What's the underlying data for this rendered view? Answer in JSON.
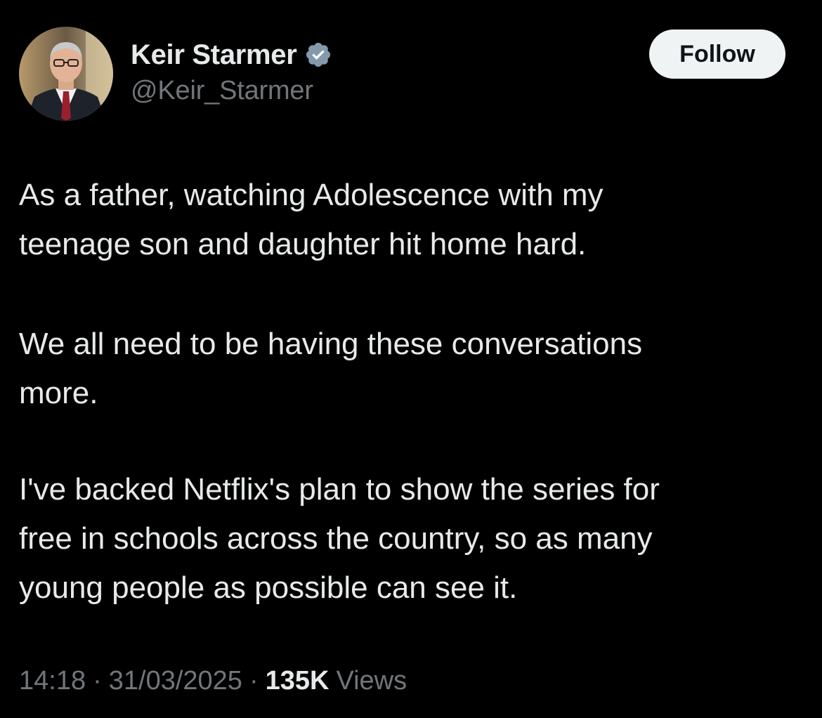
{
  "author": {
    "display_name": "Keir Starmer",
    "handle": "@Keir_Starmer",
    "verified": true,
    "avatar_icon": "profile-photo"
  },
  "follow_button": {
    "label": "Follow"
  },
  "tweet": {
    "paragraphs": [
      [
        "As a father, watching Adolescence with my",
        "teenage son and daughter hit home hard."
      ],
      [
        "We all need to be having these conversations",
        "more."
      ],
      [
        "I've backed Netflix's plan to show the series for",
        "free in schools across the country, so as many",
        "young people as possible can see it."
      ]
    ]
  },
  "meta": {
    "time": "14:18",
    "separator": "·",
    "date": "31/03/2025",
    "views_count": "135K",
    "views_label": "Views"
  },
  "colors": {
    "background": "#000000",
    "text_primary": "#e7e9ea",
    "text_secondary": "#71767b",
    "verified_badge": "#829aab",
    "follow_bg": "#eff3f4"
  }
}
